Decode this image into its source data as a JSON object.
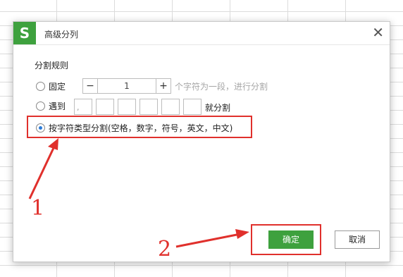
{
  "dialog": {
    "logo": "S",
    "title": "高级分列",
    "close_icon": "close-icon"
  },
  "rules": {
    "heading": "分割规则",
    "fixed": {
      "label": "固定",
      "stepper_minus": "−",
      "stepper_value": "1",
      "stepper_plus": "+",
      "hint": "个字符为一段，进行分割"
    },
    "delimiter": {
      "label": "遇到",
      "boxes": [
        ",",
        "",
        "",
        "",
        "",
        ""
      ],
      "suffix": "就分割"
    },
    "by_type": {
      "label": "按字符类型分割(空格，数字，符号，英文，中文)",
      "selected": true
    }
  },
  "buttons": {
    "ok": "确定",
    "cancel": "取消"
  },
  "annotations": {
    "marker1": "1",
    "marker2": "2",
    "color": "#e0302c"
  },
  "colors": {
    "accent": "#3ea13e",
    "radio_selected": "#2b7bd8"
  }
}
